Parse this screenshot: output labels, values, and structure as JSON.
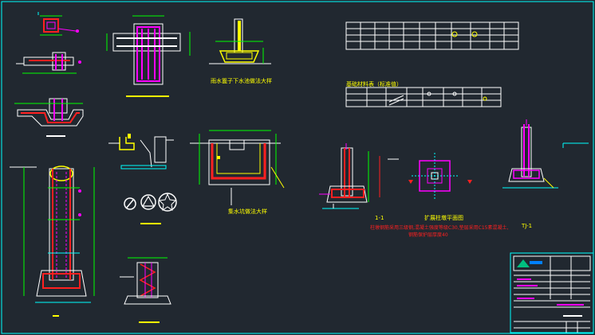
{
  "labels": {
    "detail_a": "雨水篦子下水池做法大样",
    "detail_b": "集水坑做法大样",
    "table_caption": "基础材料表（标准值）",
    "section_11": "1-1",
    "pier_plan": "扩展柱墩平面图",
    "pier_note_1": "柱墩钢筋采用三级钢,混凝土强度等级C30,垫层采用C15素混凝土,",
    "pier_note_2": "钢筋保护层厚度40",
    "section_tj1": "TJ-1"
  },
  "colors": {
    "background": "#212830",
    "frame": "#00ffff",
    "line": "#ffffff",
    "rebar": "#ff00ff",
    "concrete": "#ff2020",
    "dimension": "#00ff00",
    "note": "#ffff00",
    "link": "#0080ff"
  },
  "icons": [
    "circle-slash-icon",
    "triangle-in-circle-icon",
    "star-in-circle-icon"
  ]
}
